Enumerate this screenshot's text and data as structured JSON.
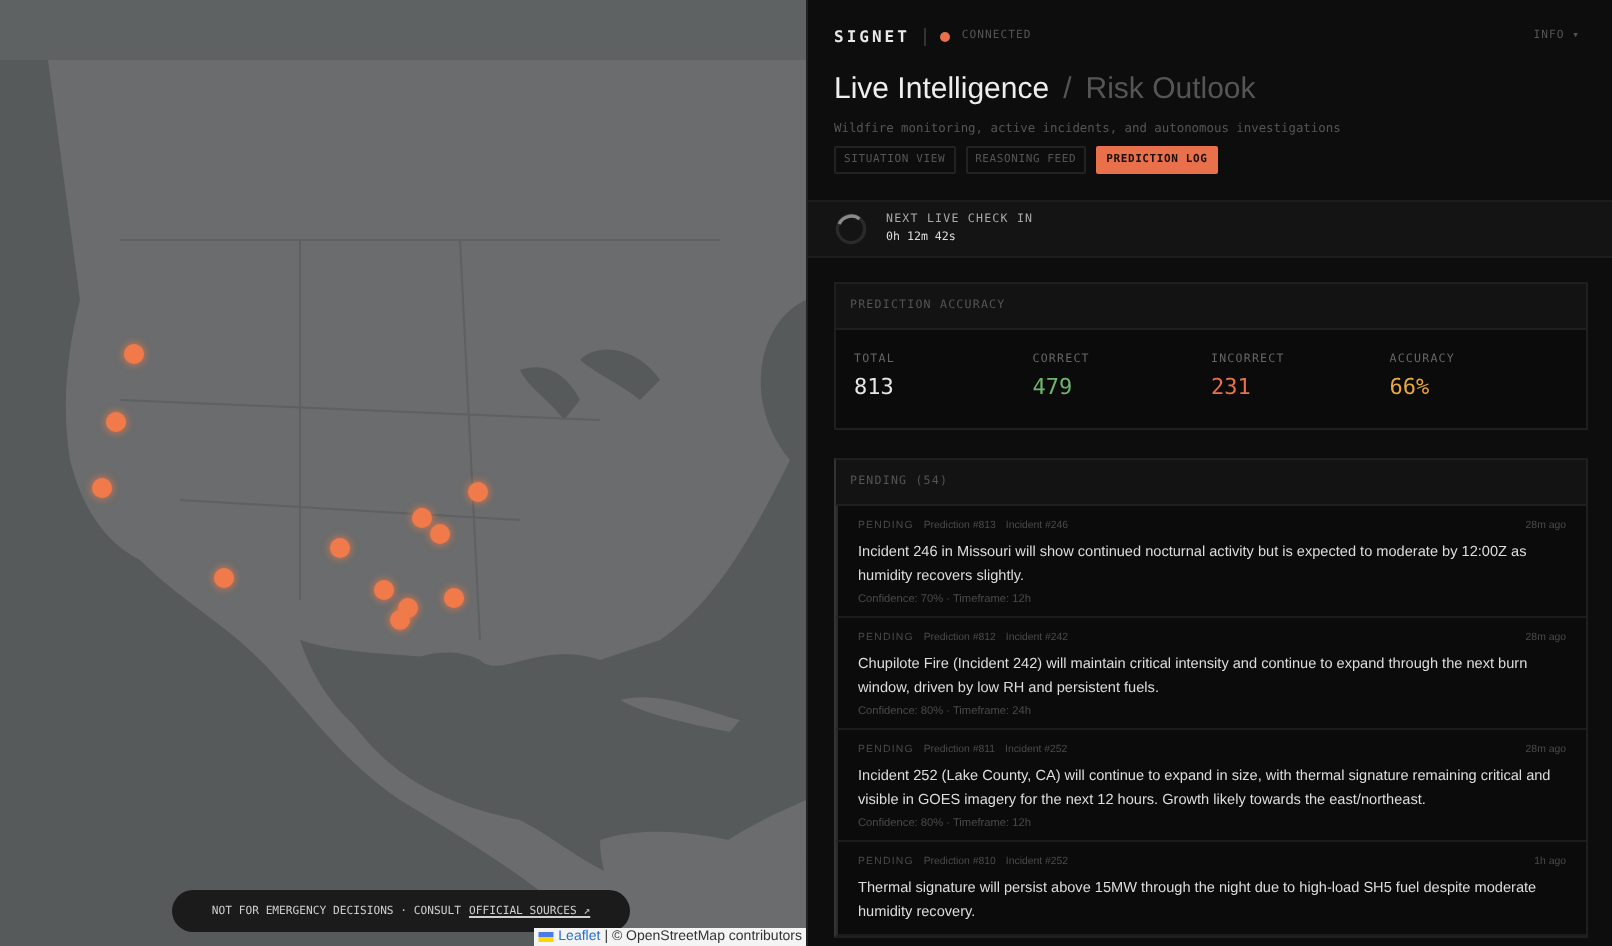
{
  "map": {
    "kind": "picture",
    "disclaimer": "NOT FOR EMERGENCY DECISIONS · CONSULT",
    "disclaimer_link": "OFFICIAL SOURCES ↗",
    "attribution_link": "Leaflet",
    "attribution": "| © OpenStreetMap contributors"
  },
  "header": {
    "brand": "SIGNET",
    "status": {
      "label": "CONNECTED",
      "online": true
    },
    "menu": "INFO ▾"
  },
  "title": {
    "main": "Live Intelligence",
    "separator": "/",
    "secondary": "Risk Outlook",
    "subtitle": "Wildfire monitoring, active incidents, and autonomous investigations"
  },
  "tabs": [
    {
      "label": "SITUATION VIEW",
      "selected": false
    },
    {
      "label": "REASONING FEED",
      "selected": false
    },
    {
      "label": "PREDICTION LOG",
      "selected": true
    }
  ],
  "countdown": {
    "label": "NEXT LIVE CHECK IN",
    "value": "0h 12m 42s"
  },
  "accuracy": {
    "title": "PREDICTION ACCURACY",
    "stats": [
      {
        "kind": "total",
        "label": "TOTAL",
        "value": "813"
      },
      {
        "kind": "correct",
        "label": "CORRECT",
        "value": "479"
      },
      {
        "kind": "incorrect",
        "label": "INCORRECT",
        "value": "231"
      },
      {
        "kind": "accuracy",
        "label": "ACCURACY",
        "value": "66%"
      }
    ]
  },
  "pending": {
    "title": "PENDING (54)",
    "items": [
      {
        "status": "PENDING",
        "prediction": "Prediction #813",
        "incident": "Incident #246",
        "time": "28m ago",
        "text": "Incident 246 in Missouri will show continued nocturnal activity but is expected to moderate by 12:00Z as humidity recovers slightly.",
        "meta": "Confidence: 70% · Timeframe: 12h"
      },
      {
        "status": "PENDING",
        "prediction": "Prediction #812",
        "incident": "Incident #242",
        "time": "28m ago",
        "text": "Chupilote Fire (Incident 242) will maintain critical intensity and continue to expand through the next burn window, driven by low RH and persistent fuels.",
        "meta": "Confidence: 80% · Timeframe: 24h"
      },
      {
        "status": "PENDING",
        "prediction": "Prediction #811",
        "incident": "Incident #252",
        "time": "28m ago",
        "text": "Incident 252 (Lake County, CA) will continue to expand in size, with thermal signature remaining critical and visible in GOES imagery for the next 12 hours. Growth likely towards the east/northeast.",
        "meta": "Confidence: 80% · Timeframe: 12h"
      },
      {
        "status": "PENDING",
        "prediction": "Prediction #810",
        "incident": "Incident #252",
        "time": "1h ago",
        "text": "Thermal signature will persist above 15MW through the night due to high-load SH5 fuel despite moderate humidity recovery."
      }
    ]
  }
}
